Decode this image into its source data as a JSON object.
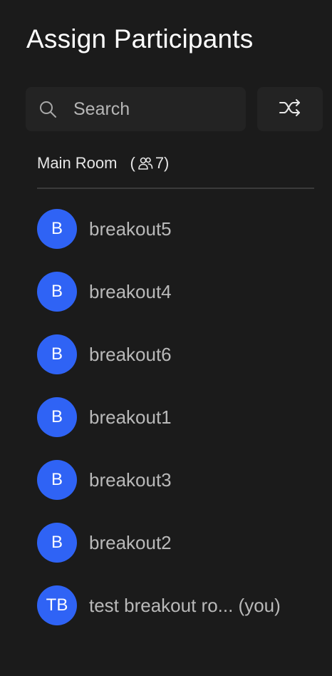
{
  "title": "Assign Participants",
  "search": {
    "placeholder": "Search",
    "value": "",
    "icon": "search-icon"
  },
  "shuffle": {
    "icon": "shuffle-icon"
  },
  "room": {
    "name": "Main Room",
    "open_paren": "(",
    "count": "7)",
    "icon": "people-icon"
  },
  "colors": {
    "background": "#1b1b1b",
    "panel": "#232323",
    "avatar": "#2f63f5",
    "name_text": "#b9b9b9"
  },
  "participants": [
    {
      "initials": "B",
      "name": "breakout5"
    },
    {
      "initials": "B",
      "name": "breakout4"
    },
    {
      "initials": "B",
      "name": "breakout6"
    },
    {
      "initials": "B",
      "name": "breakout1"
    },
    {
      "initials": "B",
      "name": "breakout3"
    },
    {
      "initials": "B",
      "name": "breakout2"
    },
    {
      "initials": "TB",
      "name": "test breakout ro... (you)"
    }
  ]
}
